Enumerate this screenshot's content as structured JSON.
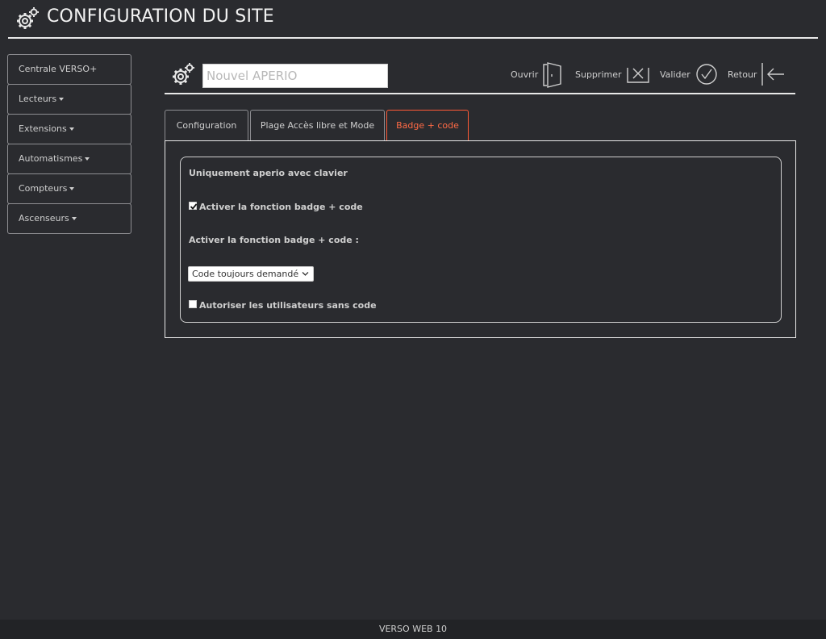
{
  "header": {
    "title": "CONFIGURATION DU SITE",
    "icon": "gears-icon"
  },
  "sidebar": {
    "items": [
      {
        "label": "Centrale VERSO+",
        "dropdown": false
      },
      {
        "label": "Lecteurs",
        "dropdown": true
      },
      {
        "label": "Extensions",
        "dropdown": true
      },
      {
        "label": "Automatismes",
        "dropdown": true
      },
      {
        "label": "Compteurs",
        "dropdown": true
      },
      {
        "label": "Ascenseurs",
        "dropdown": true
      }
    ]
  },
  "toolbar": {
    "name_placeholder": "Nouvel APERIO",
    "open_label": "Ouvrir",
    "delete_label": "Supprimer",
    "validate_label": "Valider",
    "back_label": "Retour"
  },
  "tabs": [
    {
      "label": "Configuration",
      "active": false
    },
    {
      "label": "Plage Accès libre et Mode",
      "active": false
    },
    {
      "label": "Badge + code",
      "active": true
    }
  ],
  "form": {
    "section_title": "Uniquement aperio avec clavier",
    "enable_checkbox_label": "Activer la fonction badge + code",
    "enable_checked": true,
    "mode_label": "Activer la fonction badge + code :",
    "mode_selected": "Code toujours demandé",
    "allow_nocode_label": "Autoriser les utilisateurs sans code",
    "allow_nocode_checked": false
  },
  "footer": {
    "text": "VERSO WEB 10"
  },
  "colors": {
    "background": "#2a2b2f",
    "accent": "#ff5a36",
    "rule": "#e8e8e8"
  }
}
